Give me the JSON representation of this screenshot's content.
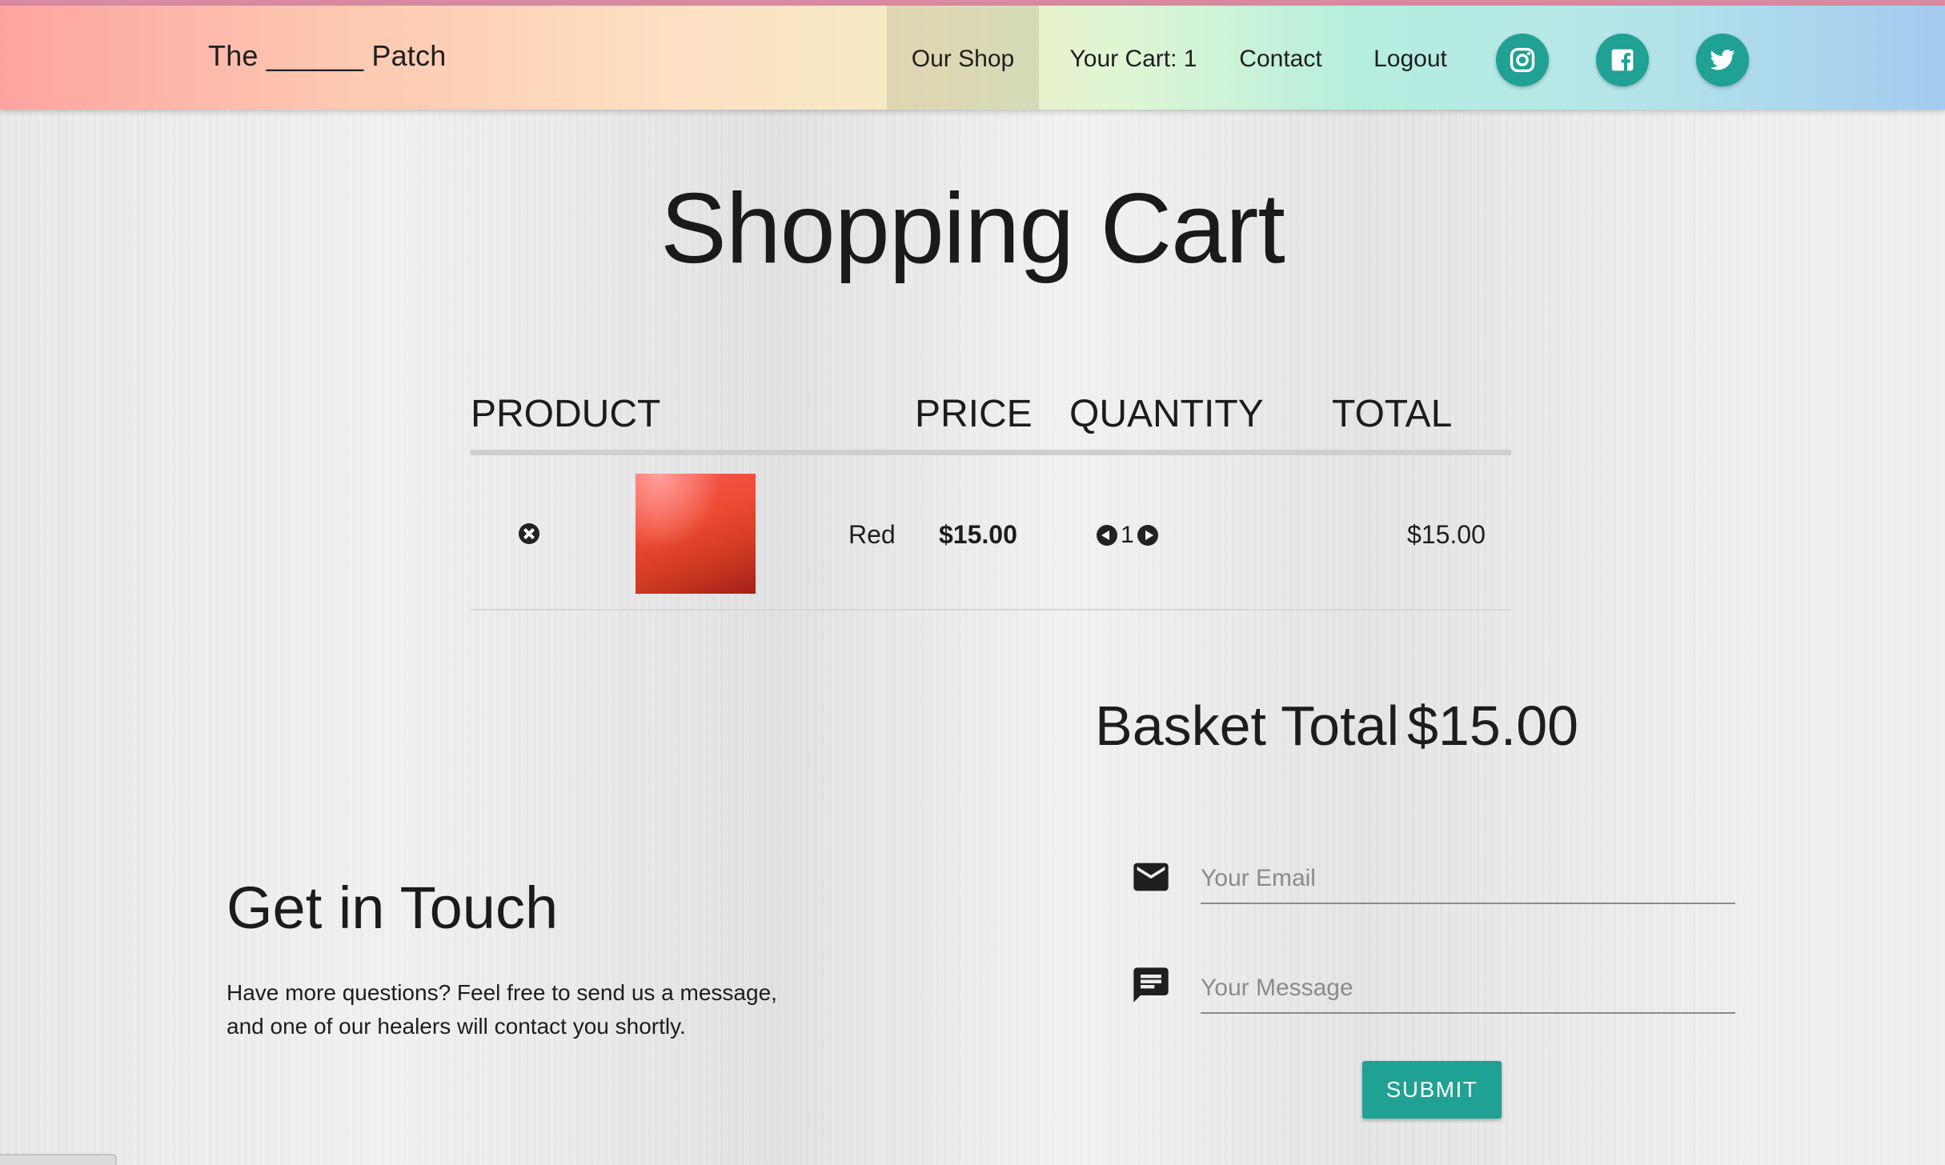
{
  "header": {
    "brand": "The ______ Patch",
    "nav": {
      "shop": "Our Shop",
      "cart": "Your Cart: 1",
      "contact": "Contact",
      "logout": "Logout"
    },
    "social_icons": [
      "instagram-icon",
      "facebook-icon",
      "twitter-icon"
    ]
  },
  "cart": {
    "title": "Shopping Cart",
    "columns": {
      "product": "PRODUCT",
      "price": "PRICE",
      "quantity": "QUANTITY",
      "total": "TOTAL"
    },
    "items": [
      {
        "name": "Red",
        "price": "$15.00",
        "quantity": "1",
        "total": "$15.00"
      }
    ],
    "basket_total_label": "Basket Total",
    "basket_total_value": "$15.00"
  },
  "contact": {
    "title": "Get in Touch",
    "text_line1": "Have more questions? Feel free to send us a message,",
    "text_line2": "and one of our healers will contact you shortly.",
    "email_placeholder": "Your Email",
    "message_placeholder": "Your Message",
    "submit_label": "SUBMIT"
  },
  "colors": {
    "accent": "#1fa193",
    "swatch": "#e8472f"
  }
}
